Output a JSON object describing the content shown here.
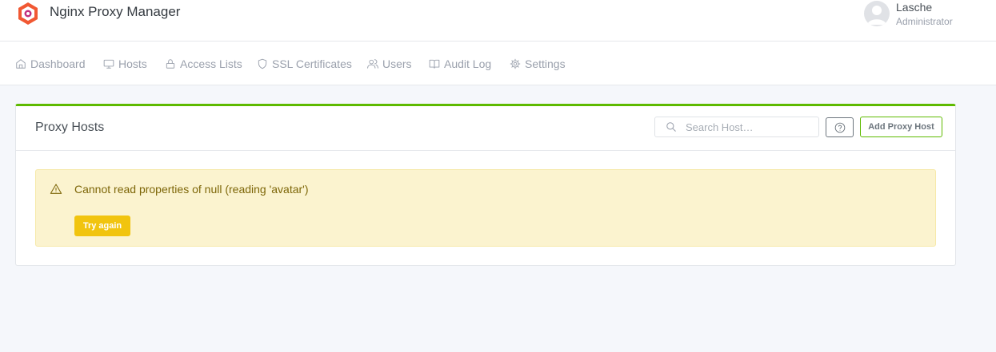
{
  "app": {
    "title": "Nginx Proxy Manager",
    "logo_icon": "nginx-proxy-manager-logo"
  },
  "user": {
    "name": "Lasche",
    "role": "Administrator",
    "avatar_icon": "user-avatar-icon"
  },
  "nav": {
    "items": [
      {
        "label": "Dashboard",
        "icon": "home-icon"
      },
      {
        "label": "Hosts",
        "icon": "monitor-icon"
      },
      {
        "label": "Access Lists",
        "icon": "lock-icon"
      },
      {
        "label": "SSL Certificates",
        "icon": "shield-icon"
      },
      {
        "label": "Users",
        "icon": "users-icon"
      },
      {
        "label": "Audit Log",
        "icon": "book-icon"
      },
      {
        "label": "Settings",
        "icon": "gear-icon"
      }
    ]
  },
  "card": {
    "title": "Proxy Hosts",
    "search_placeholder": "Search Host…",
    "help_icon": "help-circle-icon",
    "add_label": "Add Proxy Host",
    "accent_color": "#5eba00"
  },
  "alert": {
    "message": "Cannot read properties of null (reading 'avatar')",
    "retry_label": "Try again",
    "icon": "warning-icon",
    "background_color": "#fbf3cf",
    "button_color": "#f1c40f"
  }
}
